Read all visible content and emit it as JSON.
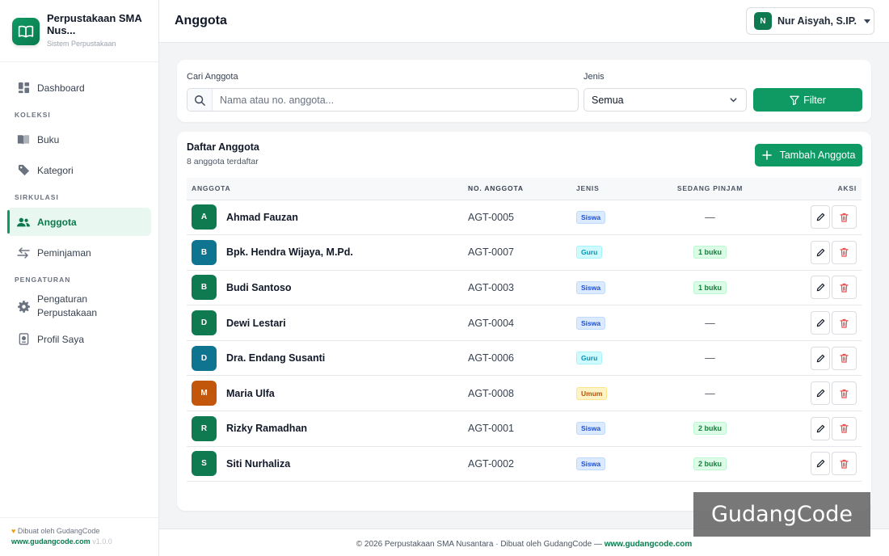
{
  "brand": {
    "title": "Perpustakaan SMA Nus...",
    "subtitle": "Sistem Perpustakaan"
  },
  "sidebar": {
    "dashboard": "Dashboard",
    "sections": [
      "KOLEKSI",
      "SIRKULASI",
      "PENGATURAN"
    ],
    "buku": "Buku",
    "kategori": "Kategori",
    "anggota": "Anggota",
    "peminjaman": "Peminjaman",
    "pengaturan_line1": "Pengaturan",
    "pengaturan_line2": "Perpustakaan",
    "profil": "Profil Saya",
    "active": "Anggota"
  },
  "sidebar_footer": {
    "made_by": "Dibuat oleh GudangCode",
    "site": "www.gudangcode.com",
    "version": "v1.0.0"
  },
  "header": {
    "title": "Anggota",
    "user_initial": "N",
    "user_name": "Nur Aisyah, S.IP."
  },
  "filter": {
    "search_label": "Cari Anggota",
    "search_placeholder": "Nama atau no. anggota...",
    "type_label": "Jenis",
    "type_value": "Semua",
    "filter_button": "Filter"
  },
  "list": {
    "title": "Daftar Anggota",
    "count_text": "8 anggota terdaftar",
    "add_button": "Tambah Anggota",
    "columns": [
      "ANGGOTA",
      "NO. ANGGOTA",
      "JENIS",
      "SEDANG PINJAM",
      "AKSI"
    ],
    "rows": [
      {
        "initial": "A",
        "name": "Ahmad Fauzan",
        "no": "AGT-0005",
        "jenis": "Siswa",
        "pinjam": "—",
        "color": "#0f7a4f"
      },
      {
        "initial": "B",
        "name": "Bpk. Hendra Wijaya, M.Pd.",
        "no": "AGT-0007",
        "jenis": "Guru",
        "pinjam": "1 buku",
        "color": "#0e7490"
      },
      {
        "initial": "B",
        "name": "Budi Santoso",
        "no": "AGT-0003",
        "jenis": "Siswa",
        "pinjam": "1 buku",
        "color": "#0f7a4f"
      },
      {
        "initial": "D",
        "name": "Dewi Lestari",
        "no": "AGT-0004",
        "jenis": "Siswa",
        "pinjam": "—",
        "color": "#0f7a4f"
      },
      {
        "initial": "D",
        "name": "Dra. Endang Susanti",
        "no": "AGT-0006",
        "jenis": "Guru",
        "pinjam": "—",
        "color": "#0e7490"
      },
      {
        "initial": "M",
        "name": "Maria Ulfa",
        "no": "AGT-0008",
        "jenis": "Umum",
        "pinjam": "—",
        "color": "#c2570c"
      },
      {
        "initial": "R",
        "name": "Rizky Ramadhan",
        "no": "AGT-0001",
        "jenis": "Siswa",
        "pinjam": "2 buku",
        "color": "#0f7a4f"
      },
      {
        "initial": "S",
        "name": "Siti Nurhaliza",
        "no": "AGT-0002",
        "jenis": "Siswa",
        "pinjam": "2 buku",
        "color": "#0f7a4f"
      }
    ]
  },
  "footer": {
    "text": "© 2026 Perpustakaan SMA Nusantara · Dibuat oleh GudangCode — ",
    "link": "www.gudangcode.com"
  },
  "watermark": "GudangCode",
  "colors": {
    "primary": "#0f9a63",
    "danger": "#ef4444"
  },
  "icons": [
    "book-open-icon",
    "dashboard-icon",
    "book-icon",
    "tag-icon",
    "users-icon",
    "swap-icon",
    "gear-icon",
    "id-card-icon",
    "search-icon",
    "chevron-down-icon",
    "funnel-icon",
    "plus-icon",
    "pencil-icon",
    "trash-icon",
    "heart-icon"
  ]
}
